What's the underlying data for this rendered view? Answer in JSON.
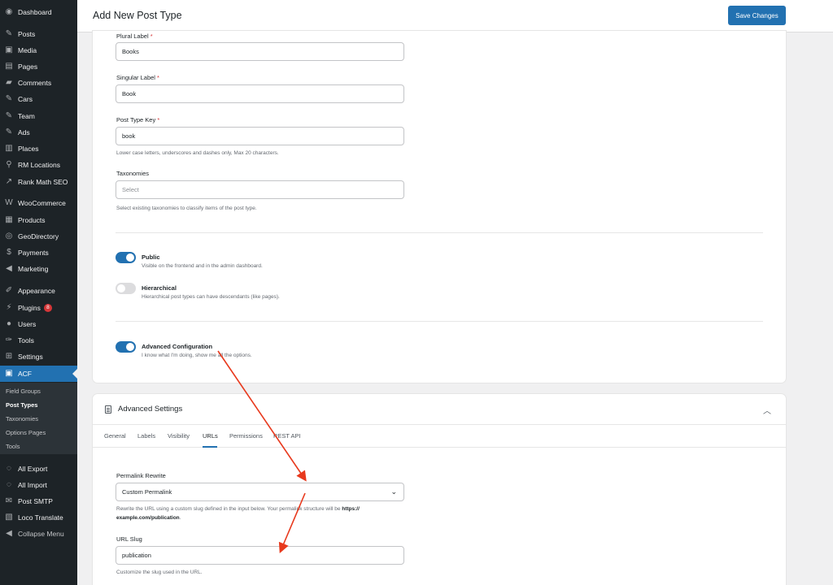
{
  "sidebar": {
    "items": [
      {
        "label": "Dashboard",
        "icon": "dashboard-icon",
        "glyph": "◉"
      },
      {
        "label": "Posts",
        "icon": "pin-icon",
        "glyph": "✎"
      },
      {
        "label": "Media",
        "icon": "media-icon",
        "glyph": "▣"
      },
      {
        "label": "Pages",
        "icon": "pages-icon",
        "glyph": "▤"
      },
      {
        "label": "Comments",
        "icon": "comments-icon",
        "glyph": "▰"
      },
      {
        "label": "Cars",
        "icon": "pin-icon",
        "glyph": "✎"
      },
      {
        "label": "Team",
        "icon": "pin-icon",
        "glyph": "✎"
      },
      {
        "label": "Ads",
        "icon": "pin-icon",
        "glyph": "✎"
      },
      {
        "label": "Places",
        "icon": "places-icon",
        "glyph": "▥"
      },
      {
        "label": "RM Locations",
        "icon": "location-pin-icon",
        "glyph": "⚲"
      },
      {
        "label": "Rank Math SEO",
        "icon": "rankmath-icon",
        "glyph": "↗"
      },
      {
        "label": "WooCommerce",
        "icon": "woocommerce-icon",
        "glyph": "W"
      },
      {
        "label": "Products",
        "icon": "products-icon",
        "glyph": "▦"
      },
      {
        "label": "GeoDirectory",
        "icon": "globe-icon",
        "glyph": "◎"
      },
      {
        "label": "Payments",
        "icon": "payments-icon",
        "glyph": "$"
      },
      {
        "label": "Marketing",
        "icon": "megaphone-icon",
        "glyph": "◀"
      },
      {
        "label": "Appearance",
        "icon": "brush-icon",
        "glyph": "✐"
      },
      {
        "label": "Plugins",
        "icon": "plugin-icon",
        "glyph": "⚡",
        "badge": "8"
      },
      {
        "label": "Users",
        "icon": "users-icon",
        "glyph": "●"
      },
      {
        "label": "Tools",
        "icon": "wrench-icon",
        "glyph": "✑"
      },
      {
        "label": "Settings",
        "icon": "settings-icon",
        "glyph": "⊞"
      },
      {
        "label": "ACF",
        "icon": "acf-icon",
        "glyph": "▣",
        "active": true
      },
      {
        "label": "All Export",
        "icon": "export-icon",
        "glyph": "◌"
      },
      {
        "label": "All Import",
        "icon": "import-icon",
        "glyph": "◌"
      },
      {
        "label": "Post SMTP",
        "icon": "mail-icon",
        "glyph": "✉"
      },
      {
        "label": "Loco Translate",
        "icon": "translate-icon",
        "glyph": "▧"
      },
      {
        "label": "Collapse Menu",
        "icon": "collapse-icon",
        "glyph": "◀"
      }
    ],
    "submenu": [
      {
        "label": "Field Groups"
      },
      {
        "label": "Post Types",
        "current": true
      },
      {
        "label": "Taxonomies"
      },
      {
        "label": "Options Pages"
      },
      {
        "label": "Tools"
      }
    ]
  },
  "header": {
    "title": "Add New Post Type",
    "save_label": "Save Changes"
  },
  "form": {
    "plural_label": "Plural Label",
    "plural_value": "Books",
    "singular_label": "Singular Label",
    "singular_value": "Book",
    "key_label": "Post Type Key",
    "key_value": "book",
    "key_help": "Lower case letters, underscores and dashes only, Max 20 characters.",
    "taxonomies_label": "Taxonomies",
    "taxonomies_placeholder": "Select",
    "taxonomies_help": "Select existing taxonomies to classify items of the post type.",
    "required_mark": "*"
  },
  "toggles": {
    "public_title": "Public",
    "public_desc": "Visible on the frontend and in the admin dashboard.",
    "public_on": true,
    "hier_title": "Hierarchical",
    "hier_desc": "Hierarchical post types can have descendants (like pages).",
    "hier_on": false,
    "adv_title": "Advanced Configuration",
    "adv_desc": "I know what I'm doing, show me all the options.",
    "adv_on": true
  },
  "advanced": {
    "title": "Advanced Settings",
    "tabs": [
      "General",
      "Labels",
      "Visibility",
      "URLs",
      "Permissions",
      "REST API"
    ],
    "active_tab": "URLs",
    "permalink_label": "Permalink Rewrite",
    "permalink_value": "Custom Permalink",
    "permalink_help": "Rewrite the URL using a custom slug defined in the input below. Your permalink structure will be",
    "permalink_help_url_1": "https://",
    "permalink_help_url_2": "example.com/publication",
    "permalink_help_end": ".",
    "slug_label": "URL Slug",
    "slug_value": "publication",
    "slug_help": "Customize the slug used in the URL."
  },
  "colors": {
    "accent": "#2271b1",
    "sidebar_bg": "#1d2327",
    "annotation_arrow": "#e8391d"
  }
}
